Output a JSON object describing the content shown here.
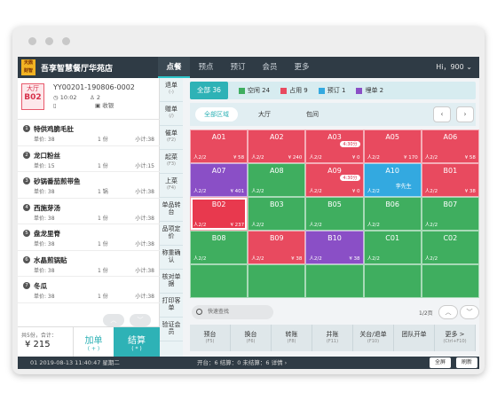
{
  "header": {
    "logo_text": "天鼎\n财智",
    "store_name": "吾享智慧餐厅华苑店",
    "nav": [
      "点餐",
      "预点",
      "预订",
      "会员",
      "更多"
    ],
    "user": "Hi，900 ⌄"
  },
  "order": {
    "table_label": "大厅",
    "table_no": "B02",
    "order_no": "YY00201-190806-0002",
    "time": "10:02",
    "guests": "2",
    "bill_icon_label": "收银"
  },
  "items": [
    {
      "num": "1",
      "name": "特供鸡脆毛肚",
      "price": "单价: 38",
      "qty": "1 份",
      "subtotal": "小计:38"
    },
    {
      "num": "2",
      "name": "龙口粉丝",
      "price": "单价: 15",
      "qty": "1 份",
      "subtotal": "小计:15"
    },
    {
      "num": "3",
      "name": "砂锅番茄煎带鱼",
      "price": "单价: 38",
      "qty": "1 锅",
      "subtotal": "小计:38"
    },
    {
      "num": "4",
      "name": "西施芽汤",
      "price": "单价: 38",
      "qty": "1 份",
      "subtotal": "小计:38"
    },
    {
      "num": "5",
      "name": "盘龙里脊",
      "price": "单价: 38",
      "qty": "1 份",
      "subtotal": "小计:38"
    },
    {
      "num": "6",
      "name": "水晶煎锅贴",
      "price": "单价: 38",
      "qty": "1 份",
      "subtotal": "小计:38"
    },
    {
      "num": "7",
      "name": "冬瓜",
      "price": "单价: 38",
      "qty": "1 份",
      "subtotal": "小计:38"
    }
  ],
  "summary": {
    "label": "共5份，合计：",
    "total": "¥ 215",
    "add": "加单",
    "add_key": "( + )",
    "pay": "结算",
    "pay_key": "( * )"
  },
  "side": [
    {
      "t": "退单",
      "k": "(-)"
    },
    {
      "t": "赠单",
      "k": "(/)"
    },
    {
      "t": "催单",
      "k": "(F2)"
    },
    {
      "t": "起菜",
      "k": "(F3)"
    },
    {
      "t": "上菜",
      "k": "(F4)"
    },
    {
      "t": "单品转台",
      "k": ""
    },
    {
      "t": "品项定价",
      "k": ""
    },
    {
      "t": "称重确认",
      "k": ""
    },
    {
      "t": "核对单据",
      "k": ""
    },
    {
      "t": "打印客单",
      "k": ""
    },
    {
      "t": "验证会员",
      "k": ""
    }
  ],
  "status": {
    "all": "全部 36",
    "free": "空闲 24",
    "occupied": "占用 9",
    "prebooked": "预订 1",
    "merged": "埋单 2",
    "c_free": "#3fae5f",
    "c_occ": "#e84a5f",
    "c_pre": "#33a9e0",
    "c_merge": "#8a4fc6"
  },
  "areas": [
    "全部区域",
    "大厅",
    "包间"
  ],
  "tables": [
    {
      "id": "A01",
      "g": "人2/2",
      "m": "¥ 58",
      "c": "#e84a5f"
    },
    {
      "id": "A02",
      "g": "人2/2",
      "m": "¥ 240",
      "c": "#e84a5f"
    },
    {
      "id": "A03",
      "g": "人2/2",
      "m": "¥ 0",
      "c": "#e84a5f",
      "tag": "4:30分"
    },
    {
      "id": "A05",
      "g": "人2/2",
      "m": "¥ 170",
      "c": "#e84a5f"
    },
    {
      "id": "A06",
      "g": "人2/2",
      "m": "¥ 58",
      "c": "#e84a5f"
    },
    {
      "id": "A07",
      "g": "人2/2",
      "m": "¥ 401",
      "c": "#8a4fc6"
    },
    {
      "id": "A08",
      "g": "人2/2",
      "m": "",
      "c": "#3fae5f"
    },
    {
      "id": "A09",
      "g": "人2/2",
      "m": "¥ 0",
      "c": "#e84a5f",
      "tag": "4:30分"
    },
    {
      "id": "A10",
      "g": "人2/2",
      "m": "",
      "c": "#33a9e0",
      "nm": "李先生"
    },
    {
      "id": "B01",
      "g": "人2/2",
      "m": "¥ 38",
      "c": "#e84a5f"
    },
    {
      "id": "B02",
      "g": "人2/2",
      "m": "¥ 237",
      "c": "#e8394e"
    },
    {
      "id": "B03",
      "g": "人2/2",
      "m": "",
      "c": "#3fae5f"
    },
    {
      "id": "B05",
      "g": "人2/2",
      "m": "",
      "c": "#3fae5f"
    },
    {
      "id": "B06",
      "g": "人2/2",
      "m": "",
      "c": "#3fae5f"
    },
    {
      "id": "B07",
      "g": "人2/2",
      "m": "",
      "c": "#3fae5f"
    },
    {
      "id": "B08",
      "g": "人2/2",
      "m": "",
      "c": "#3fae5f"
    },
    {
      "id": "B09",
      "g": "人2/2",
      "m": "¥ 38",
      "c": "#e84a5f"
    },
    {
      "id": "B10",
      "g": "人2/2",
      "m": "¥ 38",
      "c": "#8a4fc6"
    },
    {
      "id": "C01",
      "g": "人2/2",
      "m": "",
      "c": "#3fae5f"
    },
    {
      "id": "C02",
      "g": "人2/2",
      "m": "",
      "c": "#3fae5f"
    },
    {
      "id": "",
      "g": "",
      "m": "",
      "c": "#3fae5f"
    },
    {
      "id": "",
      "g": "",
      "m": "",
      "c": "#3fae5f"
    },
    {
      "id": "",
      "g": "",
      "m": "",
      "c": "#3fae5f"
    },
    {
      "id": "",
      "g": "",
      "m": "",
      "c": "#3fae5f"
    },
    {
      "id": "",
      "g": "",
      "m": "",
      "c": "#3fae5f"
    }
  ],
  "search_placeholder": "快速查找",
  "page": "1/2页",
  "actions": [
    {
      "t": "预台",
      "k": "(F5)"
    },
    {
      "t": "换台",
      "k": "(F6)"
    },
    {
      "t": "转账",
      "k": "(F8)"
    },
    {
      "t": "并账",
      "k": "(F11)"
    },
    {
      "t": "关台/退单",
      "k": "(F10)"
    },
    {
      "t": "团队开单",
      "k": ""
    },
    {
      "t": "更多 >",
      "k": "(Ctrl+F10)"
    }
  ],
  "footer": {
    "terminal": "01  2019-08-13 11:40:47 星期二",
    "counts": "开台：6    结算：0    未结算：6    详情 ›",
    "fullscreen": "全屏",
    "refresh": "刷新"
  }
}
